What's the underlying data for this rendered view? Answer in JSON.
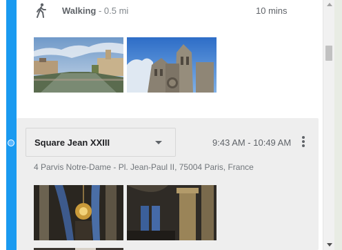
{
  "walk": {
    "icon": "walking-person-icon",
    "mode": "Walking",
    "distance": " - 0.5 mi",
    "duration": "10 mins"
  },
  "stop": {
    "place_name": "Square Jean XXIII",
    "dropdown_icon": "caret-down-icon",
    "time_range": "9:43 AM - 10:49 AM",
    "more_icon": "more-vert-icon",
    "address": "4 Parvis Notre-Dame - Pl. Jean-Paul II, 75004 Paris, France"
  },
  "photos": {
    "walk_segment": [
      "seine-river-photo",
      "notre-dame-facade-photo"
    ],
    "stop": [
      "cathedral-chandelier-interior-photo",
      "cathedral-pillars-interior-photo",
      "cathedral-interior-photo"
    ]
  },
  "colors": {
    "timeline": "#1a9af0",
    "card_background": "#eeeeee"
  }
}
